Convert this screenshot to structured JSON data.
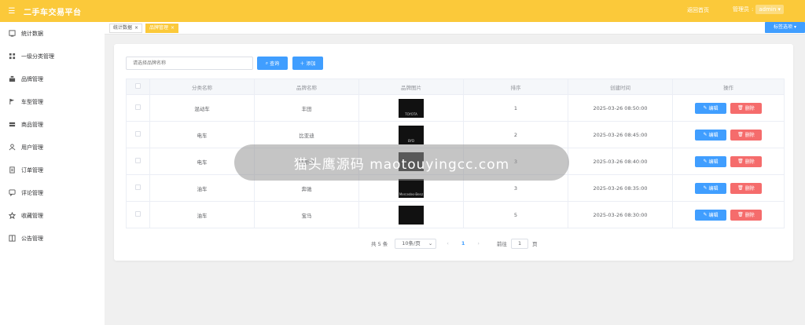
{
  "header": {
    "title": "二手车交易平台",
    "back_home": "返回首页",
    "role_label": "管理员",
    "user": "admin"
  },
  "sidebar": {
    "items": [
      {
        "label": "统计数据",
        "icon": "chart-icon"
      },
      {
        "label": "一级分类管理",
        "icon": "grid-icon"
      },
      {
        "label": "品牌管理",
        "icon": "stack-icon"
      },
      {
        "label": "车型管理",
        "icon": "flag-icon"
      },
      {
        "label": "商品管理",
        "icon": "box-icon"
      },
      {
        "label": "用户管理",
        "icon": "user-icon"
      },
      {
        "label": "订单管理",
        "icon": "document-icon"
      },
      {
        "label": "评论管理",
        "icon": "comment-icon"
      },
      {
        "label": "收藏管理",
        "icon": "star-icon"
      },
      {
        "label": "公告管理",
        "icon": "notice-icon"
      }
    ]
  },
  "tabs": [
    {
      "label": "统计数据",
      "active": false
    },
    {
      "label": "品牌管理",
      "active": true
    }
  ],
  "tab_options": "标签选项",
  "search": {
    "placeholder": "请选择品牌名称",
    "query_label": "查询",
    "add_label": "添加"
  },
  "table": {
    "headers": [
      "分类名称",
      "品牌名称",
      "品牌图片",
      "排序",
      "创建时间",
      "操作"
    ],
    "rows": [
      {
        "category": "混动车",
        "brand": "丰田",
        "sort": "1",
        "created": "2025-03-26 08:50:00",
        "logo": "TOYOTA"
      },
      {
        "category": "电车",
        "brand": "比亚迪",
        "sort": "2",
        "created": "2025-03-26 08:45:00",
        "logo": "BYD"
      },
      {
        "category": "电车",
        "brand": "特斯拉",
        "sort": "3",
        "created": "2025-03-26 08:40:00",
        "logo": ""
      },
      {
        "category": "油车",
        "brand": "奔驰",
        "sort": "3",
        "created": "2025-03-26 08:35:00",
        "logo": "Mercedes-Benz"
      },
      {
        "category": "油车",
        "brand": "宝马",
        "sort": "5",
        "created": "2025-03-26 08:30:00",
        "logo": ""
      }
    ],
    "edit_label": "编辑",
    "delete_label": "删除"
  },
  "pagination": {
    "total": "共 5 条",
    "page_size": "10条/页",
    "current_page": "1",
    "goto": "前往",
    "goto_value": "1",
    "unit": "页"
  },
  "watermark": "猫头鹰源码 maotouyingcc.com",
  "colors": {
    "header": "#fbc93a",
    "primary": "#409eff",
    "danger": "#f56c6c"
  }
}
